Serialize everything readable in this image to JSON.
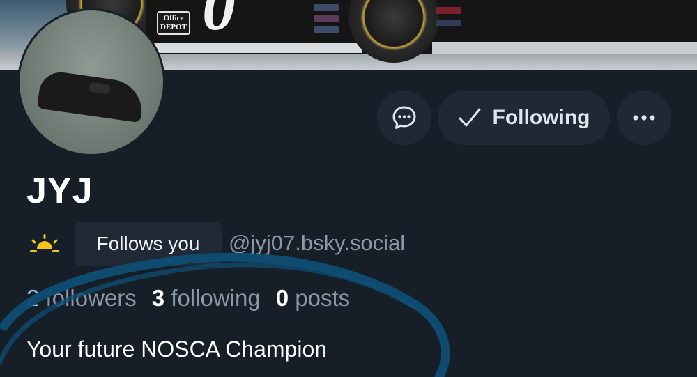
{
  "profile": {
    "display_name": "JYJ",
    "follows_you_label": "Follows you",
    "handle": "@jyj07.bsky.social",
    "bio": "Your future NOSCA Champion",
    "banner_sponsor": "Office DEPOT"
  },
  "actions": {
    "message_icon": "chat-bubble-icon",
    "following_label": "Following",
    "following_icon": "check-icon",
    "more_icon": "more-dots-icon"
  },
  "stats": {
    "followers_count": "2",
    "followers_label": "followers",
    "following_count": "3",
    "following_label": "following",
    "posts_count": "0",
    "posts_label": "posts"
  },
  "icons": {
    "pronoun_icon": "sunrise-icon"
  },
  "colors": {
    "background": "#161e27",
    "button_bg": "#1e2935",
    "badge_bg": "#1f2a36",
    "muted_text": "#8b98a8",
    "sun_yellow": "#f5c518",
    "annotation_blue": "#0f4d73"
  }
}
